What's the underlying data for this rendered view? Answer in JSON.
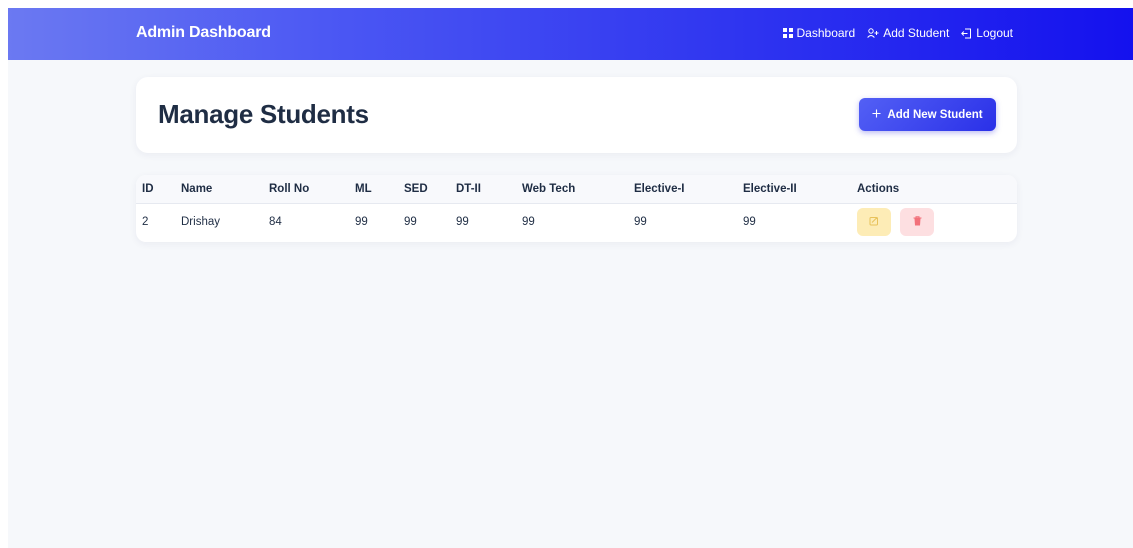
{
  "navbar": {
    "brand": "Admin Dashboard",
    "links": [
      {
        "icon": "grid-icon",
        "label": "Dashboard"
      },
      {
        "icon": "user-plus-icon",
        "label": "Add Student"
      },
      {
        "icon": "logout-icon",
        "label": "Logout"
      }
    ]
  },
  "header": {
    "title": "Manage Students",
    "add_button": "Add New Student"
  },
  "table": {
    "columns": [
      "ID",
      "Name",
      "Roll No",
      "ML",
      "SED",
      "DT-II",
      "Web Tech",
      "Elective-I",
      "Elective-II",
      "Actions"
    ],
    "rows": [
      {
        "cells": [
          "2",
          "Drishay",
          "84",
          "99",
          "99",
          "99",
          "99",
          "99",
          "99"
        ]
      }
    ]
  },
  "colors": {
    "navbar_start": "#6b79f2",
    "navbar_end": "#1411ee",
    "accent": "#3d48f0",
    "edit_bg": "#fdecb6",
    "delete_bg": "#fddfe1"
  }
}
